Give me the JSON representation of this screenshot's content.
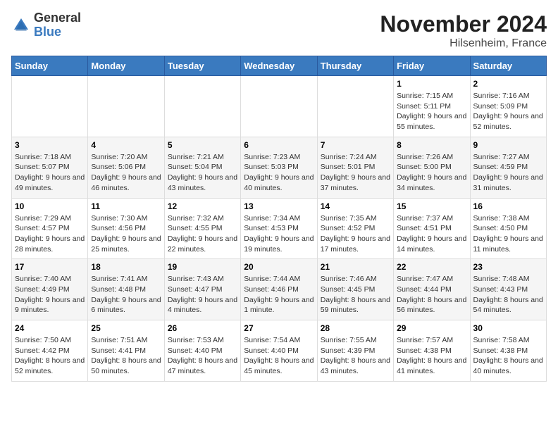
{
  "logo": {
    "general": "General",
    "blue": "Blue"
  },
  "header": {
    "month": "November 2024",
    "location": "Hilsenheim, France"
  },
  "days_of_week": [
    "Sunday",
    "Monday",
    "Tuesday",
    "Wednesday",
    "Thursday",
    "Friday",
    "Saturday"
  ],
  "weeks": [
    [
      {
        "day": "",
        "info": ""
      },
      {
        "day": "",
        "info": ""
      },
      {
        "day": "",
        "info": ""
      },
      {
        "day": "",
        "info": ""
      },
      {
        "day": "",
        "info": ""
      },
      {
        "day": "1",
        "info": "Sunrise: 7:15 AM\nSunset: 5:11 PM\nDaylight: 9 hours and 55 minutes."
      },
      {
        "day": "2",
        "info": "Sunrise: 7:16 AM\nSunset: 5:09 PM\nDaylight: 9 hours and 52 minutes."
      }
    ],
    [
      {
        "day": "3",
        "info": "Sunrise: 7:18 AM\nSunset: 5:07 PM\nDaylight: 9 hours and 49 minutes."
      },
      {
        "day": "4",
        "info": "Sunrise: 7:20 AM\nSunset: 5:06 PM\nDaylight: 9 hours and 46 minutes."
      },
      {
        "day": "5",
        "info": "Sunrise: 7:21 AM\nSunset: 5:04 PM\nDaylight: 9 hours and 43 minutes."
      },
      {
        "day": "6",
        "info": "Sunrise: 7:23 AM\nSunset: 5:03 PM\nDaylight: 9 hours and 40 minutes."
      },
      {
        "day": "7",
        "info": "Sunrise: 7:24 AM\nSunset: 5:01 PM\nDaylight: 9 hours and 37 minutes."
      },
      {
        "day": "8",
        "info": "Sunrise: 7:26 AM\nSunset: 5:00 PM\nDaylight: 9 hours and 34 minutes."
      },
      {
        "day": "9",
        "info": "Sunrise: 7:27 AM\nSunset: 4:59 PM\nDaylight: 9 hours and 31 minutes."
      }
    ],
    [
      {
        "day": "10",
        "info": "Sunrise: 7:29 AM\nSunset: 4:57 PM\nDaylight: 9 hours and 28 minutes."
      },
      {
        "day": "11",
        "info": "Sunrise: 7:30 AM\nSunset: 4:56 PM\nDaylight: 9 hours and 25 minutes."
      },
      {
        "day": "12",
        "info": "Sunrise: 7:32 AM\nSunset: 4:55 PM\nDaylight: 9 hours and 22 minutes."
      },
      {
        "day": "13",
        "info": "Sunrise: 7:34 AM\nSunset: 4:53 PM\nDaylight: 9 hours and 19 minutes."
      },
      {
        "day": "14",
        "info": "Sunrise: 7:35 AM\nSunset: 4:52 PM\nDaylight: 9 hours and 17 minutes."
      },
      {
        "day": "15",
        "info": "Sunrise: 7:37 AM\nSunset: 4:51 PM\nDaylight: 9 hours and 14 minutes."
      },
      {
        "day": "16",
        "info": "Sunrise: 7:38 AM\nSunset: 4:50 PM\nDaylight: 9 hours and 11 minutes."
      }
    ],
    [
      {
        "day": "17",
        "info": "Sunrise: 7:40 AM\nSunset: 4:49 PM\nDaylight: 9 hours and 9 minutes."
      },
      {
        "day": "18",
        "info": "Sunrise: 7:41 AM\nSunset: 4:48 PM\nDaylight: 9 hours and 6 minutes."
      },
      {
        "day": "19",
        "info": "Sunrise: 7:43 AM\nSunset: 4:47 PM\nDaylight: 9 hours and 4 minutes."
      },
      {
        "day": "20",
        "info": "Sunrise: 7:44 AM\nSunset: 4:46 PM\nDaylight: 9 hours and 1 minute."
      },
      {
        "day": "21",
        "info": "Sunrise: 7:46 AM\nSunset: 4:45 PM\nDaylight: 8 hours and 59 minutes."
      },
      {
        "day": "22",
        "info": "Sunrise: 7:47 AM\nSunset: 4:44 PM\nDaylight: 8 hours and 56 minutes."
      },
      {
        "day": "23",
        "info": "Sunrise: 7:48 AM\nSunset: 4:43 PM\nDaylight: 8 hours and 54 minutes."
      }
    ],
    [
      {
        "day": "24",
        "info": "Sunrise: 7:50 AM\nSunset: 4:42 PM\nDaylight: 8 hours and 52 minutes."
      },
      {
        "day": "25",
        "info": "Sunrise: 7:51 AM\nSunset: 4:41 PM\nDaylight: 8 hours and 50 minutes."
      },
      {
        "day": "26",
        "info": "Sunrise: 7:53 AM\nSunset: 4:40 PM\nDaylight: 8 hours and 47 minutes."
      },
      {
        "day": "27",
        "info": "Sunrise: 7:54 AM\nSunset: 4:40 PM\nDaylight: 8 hours and 45 minutes."
      },
      {
        "day": "28",
        "info": "Sunrise: 7:55 AM\nSunset: 4:39 PM\nDaylight: 8 hours and 43 minutes."
      },
      {
        "day": "29",
        "info": "Sunrise: 7:57 AM\nSunset: 4:38 PM\nDaylight: 8 hours and 41 minutes."
      },
      {
        "day": "30",
        "info": "Sunrise: 7:58 AM\nSunset: 4:38 PM\nDaylight: 8 hours and 40 minutes."
      }
    ]
  ]
}
